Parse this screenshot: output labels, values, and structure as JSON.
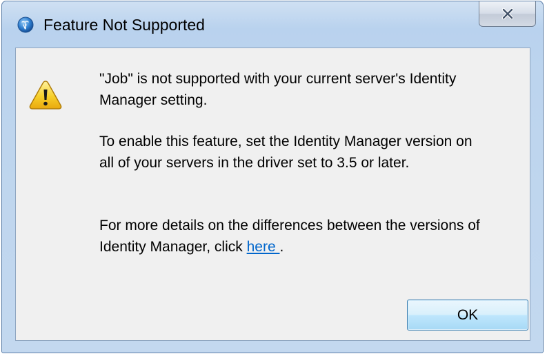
{
  "window": {
    "title": "Feature Not Supported",
    "app_icon": "app-globe-icon",
    "close_icon": "close-icon"
  },
  "message": {
    "icon": "warning-icon",
    "line1": "\"Job\" is not supported with your current server's Identity",
    "line2": "Manager setting.",
    "line3": "To enable this feature, set the Identity Manager version on",
    "line4": "all of your servers in the driver set to 3.5 or later.",
    "line5": "For more details on the differences between the versions of",
    "line6_prefix": "Identity Manager, click ",
    "link_text": " here ",
    "line6_suffix": "."
  },
  "buttons": {
    "ok_label": "OK"
  },
  "colors": {
    "titlebar": "#b9d2ee",
    "client_bg": "#f0f0f0",
    "link": "#0066cc",
    "ok_border": "#3c7fb1"
  }
}
